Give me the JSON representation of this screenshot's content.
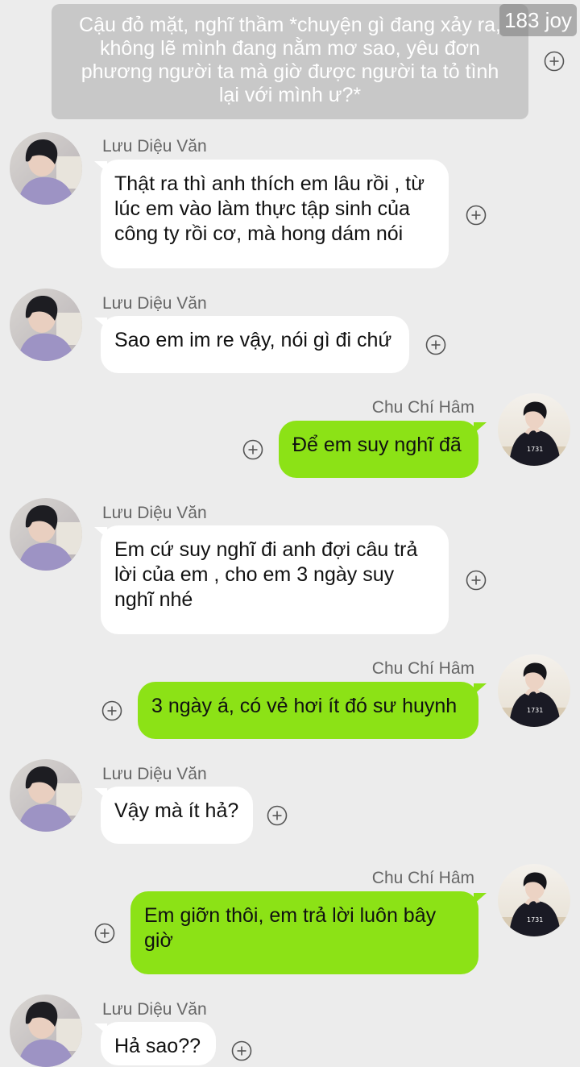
{
  "narration": "Cậu đỏ mặt, nghĩ thầm *chuyện gì đang xảy ra, không lẽ mình đang nằm mơ sao, yêu đơn phương người ta mà giờ được người ta tỏ tình lại với mình ư?*",
  "watermark": "183 joy",
  "messages": [
    {
      "sender": "Lưu Diệu Văn",
      "text": "Thật ra thì anh thích em lâu rồi , từ lúc em vào làm thực tập sinh của công ty rồi cơ, mà hong dám nói"
    },
    {
      "sender": "Lưu Diệu Văn",
      "text": "Sao em im re vậy, nói gì đi chứ"
    },
    {
      "sender": "Chu Chí Hâm",
      "text": "Để em suy nghĩ đã"
    },
    {
      "sender": "Lưu Diệu Văn",
      "text": "Em cứ suy nghĩ đi anh đợi câu trả lời của em , cho em 3 ngày suy nghĩ nhé"
    },
    {
      "sender": "Chu Chí Hâm",
      "text": "3 ngày á, có vẻ hơi ít đó sư huynh"
    },
    {
      "sender": "Lưu Diệu Văn",
      "text": "Vậy mà ít hả?"
    },
    {
      "sender": "Chu Chí Hâm",
      "text": "Em giỡn thôi, em trả lời luôn bây giờ"
    },
    {
      "sender": "Lưu Diệu Văn",
      "text": "Hả sao??"
    }
  ],
  "colors": {
    "background": "#ececec",
    "sent_bubble": "#8ce216",
    "received_bubble": "#ffffff",
    "narration_box": "#c8c8c8"
  },
  "icons": {
    "add": "plus-circle-icon",
    "avatar_left": "avatar-luu-dieu-van",
    "avatar_right": "avatar-chu-chi-ham"
  }
}
